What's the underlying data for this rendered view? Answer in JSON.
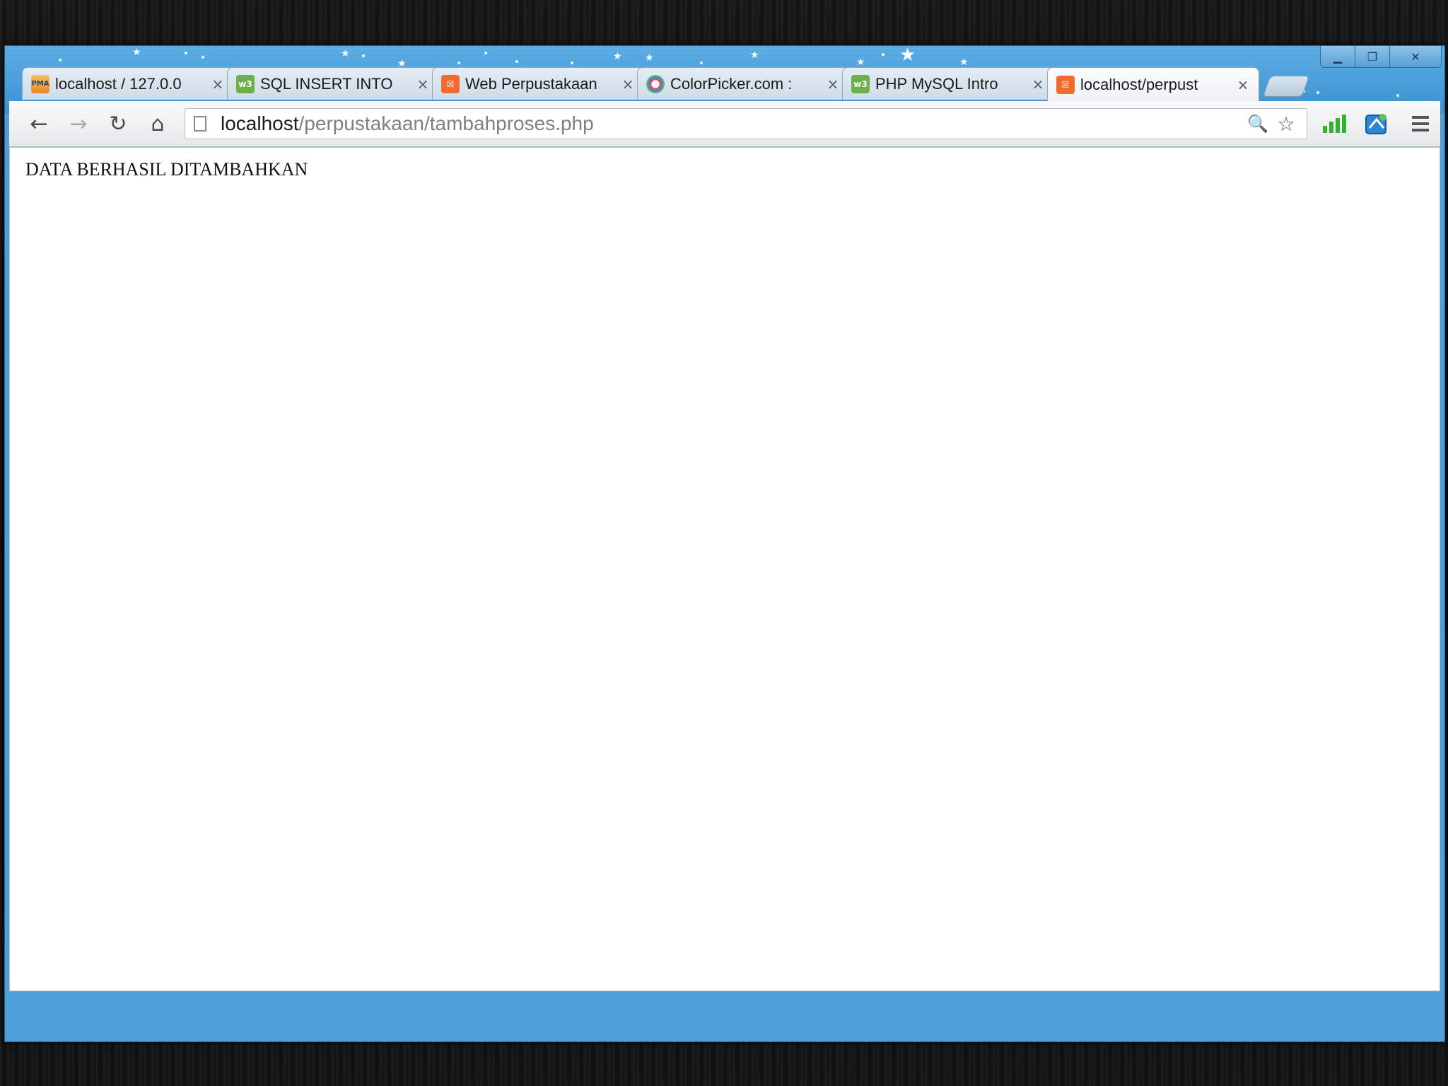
{
  "browser": {
    "tabs": [
      {
        "title": "localhost / 127.0.0",
        "favicon": "phpmyadmin-icon",
        "active": false
      },
      {
        "title": "SQL INSERT INTO",
        "favicon": "w3schools-icon",
        "active": false
      },
      {
        "title": "Web Perpustakaan",
        "favicon": "xampp-icon",
        "active": false
      },
      {
        "title": "ColorPicker.com :",
        "favicon": "color-wheel-icon",
        "active": false
      },
      {
        "title": "PHP MySQL Intro",
        "favicon": "w3schools-icon",
        "active": false
      },
      {
        "title": "localhost/perpust",
        "favicon": "xampp-icon",
        "active": true
      }
    ],
    "tab_close_glyph": "×",
    "favicon_text": {
      "pma": "PMA",
      "w3": "w3",
      "xampp": "☒"
    },
    "window_controls": {
      "minimize": "▁",
      "maximize": "❐",
      "close": "✕"
    },
    "address": {
      "host": "localhost",
      "path": "/perpustakaan/tambahproses.php"
    },
    "nav": {
      "back": "←",
      "forward": "→",
      "reload": "↻",
      "home": "⌂"
    },
    "omnibox_icons": {
      "search": "🔍",
      "bookmark": "☆"
    },
    "extension_icons": [
      "signal-bars-icon",
      "blue-puzzle-icon",
      "menu-icon"
    ],
    "theme_color": "#4f9fd8"
  },
  "page": {
    "message": "DATA BERHASIL DITAMBAHKAN"
  }
}
